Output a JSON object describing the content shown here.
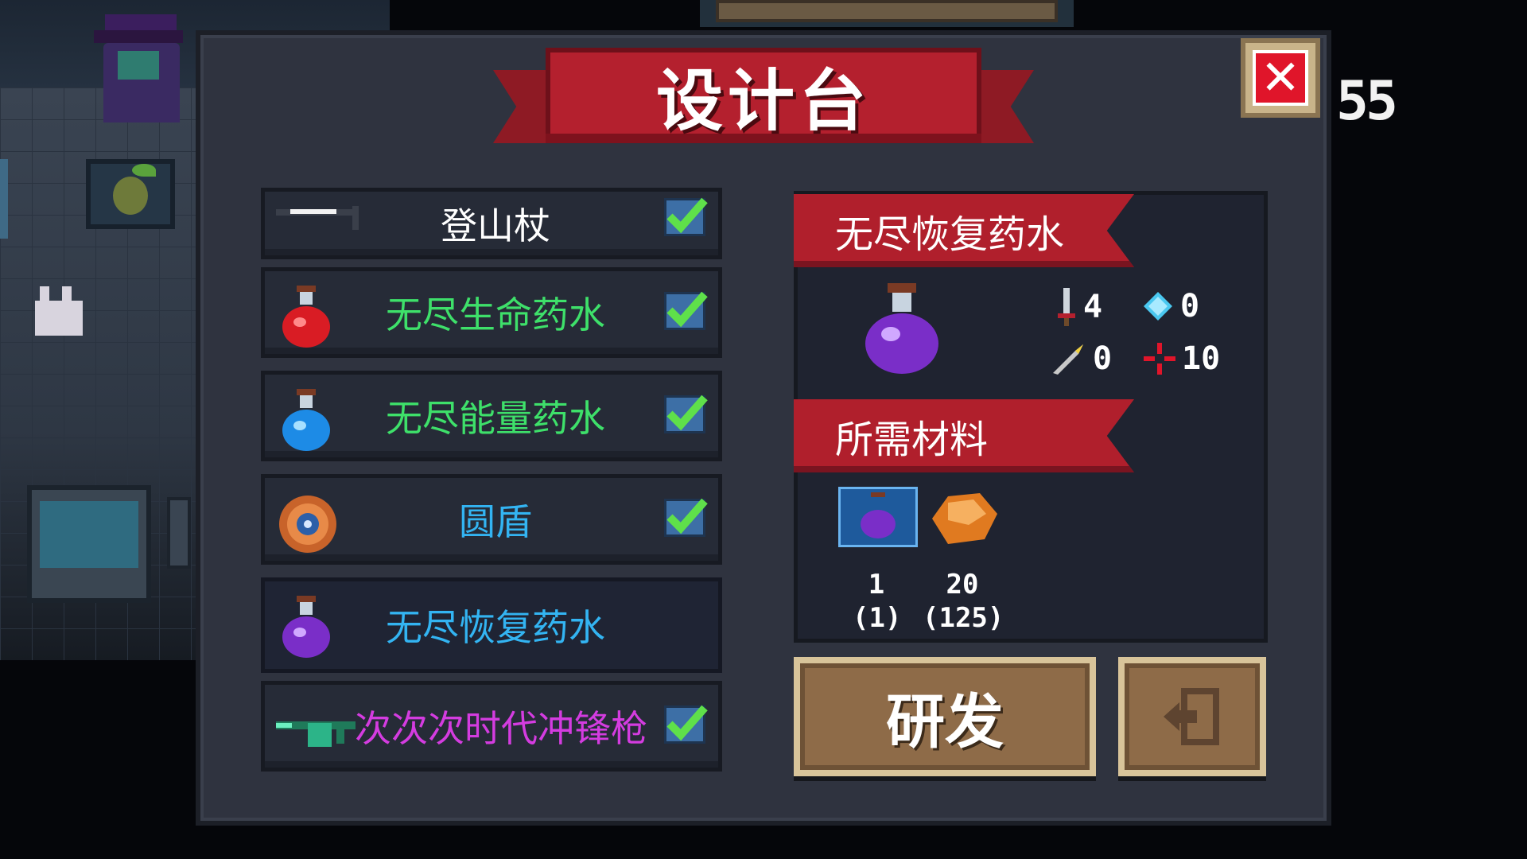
{
  "hud": {
    "digits": "55"
  },
  "dialog": {
    "title": "设计台",
    "close_symbol": "✕"
  },
  "list": {
    "items": [
      {
        "label": "登山杖",
        "color": "#ffffff",
        "icon": "walking-stick-icon",
        "checked": true
      },
      {
        "label": "无尽生命药水",
        "color": "#3ee06a",
        "icon": "red-potion-icon",
        "checked": true
      },
      {
        "label": "无尽能量药水",
        "color": "#3ee06a",
        "icon": "blue-potion-icon",
        "checked": true
      },
      {
        "label": "圆盾",
        "color": "#33b4f2",
        "icon": "round-shield-icon",
        "checked": true
      },
      {
        "label": "无尽恢复药水",
        "color": "#33b4f2",
        "icon": "purple-potion-icon",
        "checked": false,
        "selected": true
      },
      {
        "label": "次次次时代冲锋枪",
        "color": "#d43ce0",
        "icon": "smg-icon",
        "checked": true
      }
    ]
  },
  "detail": {
    "item_name": "无尽恢复药水",
    "stats": {
      "attack": "4",
      "mana_cost": "0",
      "crit": "0",
      "accuracy": "10"
    },
    "materials_title": "所需材料",
    "materials": [
      {
        "icon": "blueprint-icon",
        "required": "1",
        "owned": "(1)"
      },
      {
        "icon": "ore-icon",
        "required": "20",
        "owned": "(125)"
      }
    ]
  },
  "buttons": {
    "develop_label": "研发",
    "exit_icon": "exit-icon"
  },
  "colors": {
    "ribbon_red": "#b4202e",
    "panel_bg": "#2f333f",
    "button_brown": "#8e6b48",
    "check_green": "#5fe04a"
  }
}
